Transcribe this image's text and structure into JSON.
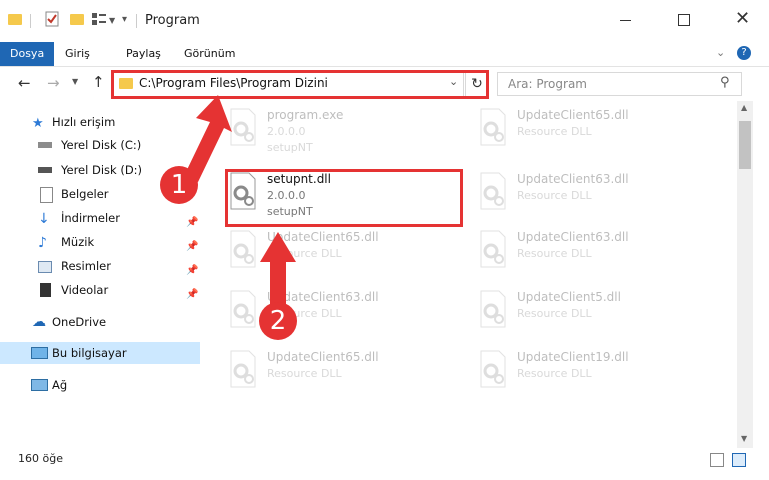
{
  "window": {
    "title": "Program"
  },
  "ribbon": {
    "tabs": [
      "Dosya",
      "Giriş",
      "Paylaş",
      "Görünüm"
    ]
  },
  "address": {
    "path": "C:\\Program Files\\Program Dizini",
    "search_placeholder": "Ara: Program"
  },
  "nav": {
    "quick_access": "Hızlı erişim",
    "items": [
      "Yerel Disk (C:)",
      "Yerel Disk (D:)",
      "Belgeler",
      "İndirmeler",
      "Müzik",
      "Resimler",
      "Videolar"
    ],
    "onedrive": "OneDrive",
    "this_pc": "Bu bilgisayar",
    "network": "Ağ"
  },
  "files": [
    {
      "name": "program.exe",
      "line1": "2.0.0.0",
      "line2": "setupNT",
      "faded": true
    },
    {
      "name": "UpdateClient65.dll",
      "line1": "Resource DLL",
      "line2": "",
      "faded": true
    },
    {
      "name": "setupnt.dll",
      "line1": "2.0.0.0",
      "line2": "setupNT",
      "faded": false
    },
    {
      "name": "UpdateClient63.dll",
      "line1": "Resource DLL",
      "line2": "",
      "faded": true
    },
    {
      "name": "UpdateClient65.dll",
      "line1": "Resource DLL",
      "line2": "",
      "faded": true
    },
    {
      "name": "UpdateClient63.dll",
      "line1": "Resource DLL",
      "line2": "",
      "faded": true
    },
    {
      "name": "UpdateClient63.dll",
      "line1": "Resource DLL",
      "line2": "",
      "faded": true
    },
    {
      "name": "UpdateClient5.dll",
      "line1": "Resource DLL",
      "line2": "",
      "faded": true
    },
    {
      "name": "UpdateClient65.dll",
      "line1": "Resource DLL",
      "line2": "",
      "faded": true
    },
    {
      "name": "UpdateClient19.dll",
      "line1": "Resource DLL",
      "line2": "",
      "faded": true
    }
  ],
  "status": {
    "count": "160 öğe"
  },
  "annotations": {
    "step1": "1",
    "step2": "2"
  },
  "colors": {
    "accent": "#1f67b4",
    "highlight": "#e53333",
    "selected_nav": "#cce8ff"
  }
}
